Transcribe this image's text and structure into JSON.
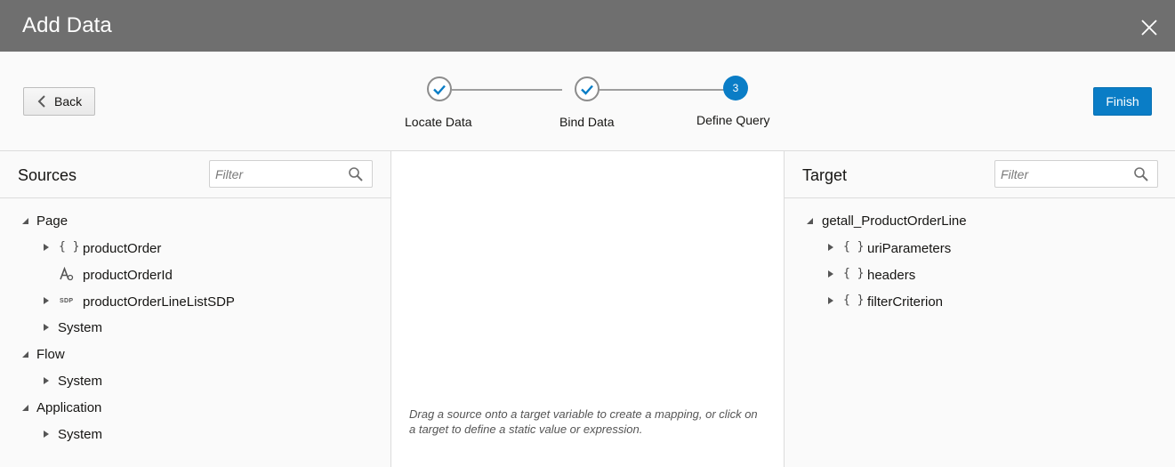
{
  "dialog": {
    "title": "Add Data"
  },
  "toolbar": {
    "back_label": "Back",
    "finish_label": "Finish"
  },
  "steps": [
    {
      "label": "Locate Data",
      "state": "done"
    },
    {
      "label": "Bind Data",
      "state": "done"
    },
    {
      "number": "3",
      "label": "Define Query",
      "state": "current"
    }
  ],
  "sources": {
    "title": "Sources",
    "filter_placeholder": "Filter",
    "tree": {
      "page": "Page",
      "productOrder": "productOrder",
      "productOrderId": "productOrderId",
      "productOrderLineListSDP": "productOrderLineListSDP",
      "sdp_badge": "SDP",
      "page_system": "System",
      "flow": "Flow",
      "flow_system": "System",
      "application": "Application",
      "app_system": "System"
    }
  },
  "mapping": {
    "hint": "Drag a source onto a target variable to create a mapping, or click on a target to define a static value or expression."
  },
  "target": {
    "title": "Target",
    "filter_placeholder": "Filter",
    "tree": {
      "root": "getall_ProductOrderLine",
      "uriParameters": "uriParameters",
      "headers": "headers",
      "filterCriterion": "filterCriterion"
    }
  },
  "icons": {
    "object": "{ }",
    "colors": {
      "accent": "#0a7dc6",
      "titlebar": "#6f6f6f"
    }
  }
}
